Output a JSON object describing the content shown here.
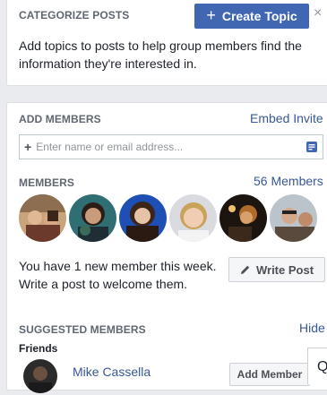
{
  "categorize": {
    "title": "CATEGORIZE POSTS",
    "create_button": "Create Topic",
    "close_glyph": "×",
    "description": "Add topics to posts to help group members find the information they're interested in."
  },
  "add_members": {
    "title": "ADD MEMBERS",
    "embed_link": "Embed Invite",
    "input_placeholder": "Enter name or email address..."
  },
  "members": {
    "title": "MEMBERS",
    "count_link": "56 Members",
    "avatar_count": 6
  },
  "welcome": {
    "text": "You have 1 new member this week. Write a post to welcome them.",
    "write_post_button": "Write Post"
  },
  "suggested": {
    "title": "SUGGESTED MEMBERS",
    "hide_link": "Hide",
    "friends_label": "Friends",
    "first_name": "Mike Cassella",
    "add_button": "Add Member"
  },
  "chat": {
    "glyph": "Q"
  },
  "colors": {
    "brand_blue": "#4267b2",
    "link_blue": "#385898",
    "page_bg": "#e9ebee"
  }
}
